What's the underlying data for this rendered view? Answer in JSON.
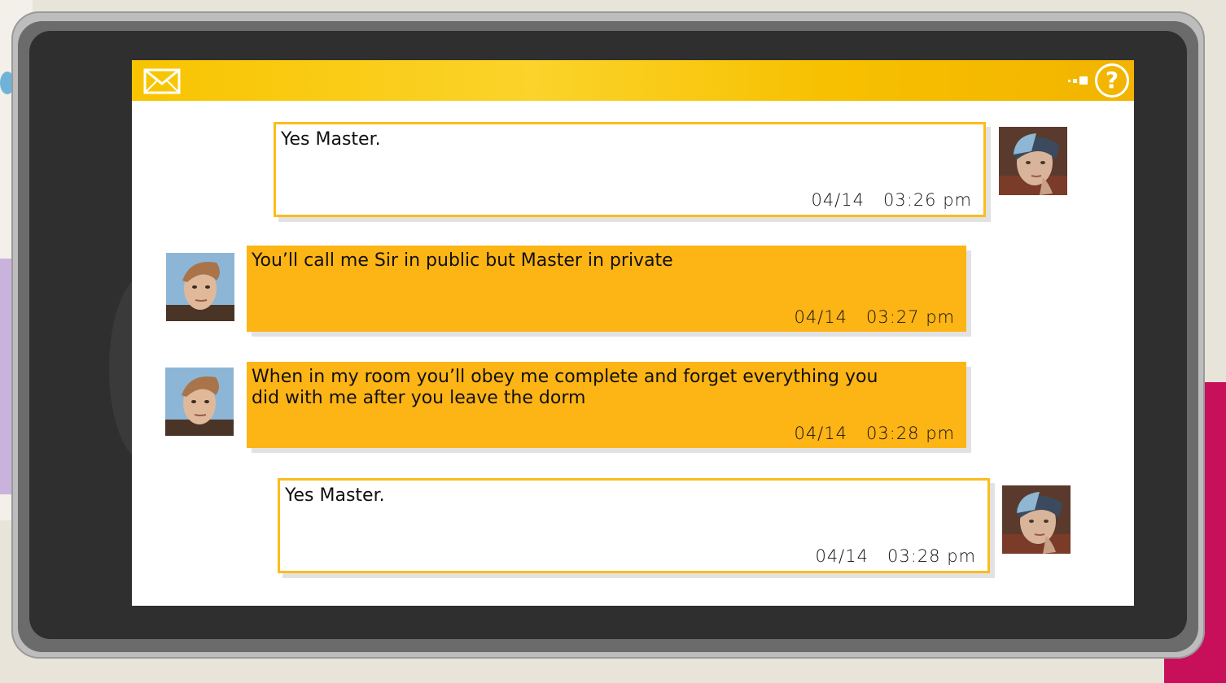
{
  "header": {
    "mail_icon": "envelope-icon",
    "signal_icon": "signal-dots-icon",
    "help_label": "?",
    "accent_color": "#f8c400"
  },
  "messages": [
    {
      "direction": "outgoing",
      "text": "Yes Master.",
      "date": "04/14",
      "time": "03:26 pm",
      "avatar": "female-contact-avatar"
    },
    {
      "direction": "incoming",
      "text": "You’ll call me Sir in public but Master in private",
      "date": "04/14",
      "time": "03:27 pm",
      "avatar": "male-contact-avatar"
    },
    {
      "direction": "incoming",
      "text": "When in my room you’ll obey me complete and forget everything you did with me after you leave the dorm",
      "date": "04/14",
      "time": "03:28 pm",
      "avatar": "male-contact-avatar"
    },
    {
      "direction": "outgoing",
      "text": "Yes Master.",
      "date": "04/14",
      "time": "03:28 pm",
      "avatar": "female-contact-avatar"
    }
  ],
  "colors": {
    "incoming_bubble": "#fdb415",
    "outgoing_border": "#fbbd1c",
    "screen_bg": "#ffffff"
  }
}
